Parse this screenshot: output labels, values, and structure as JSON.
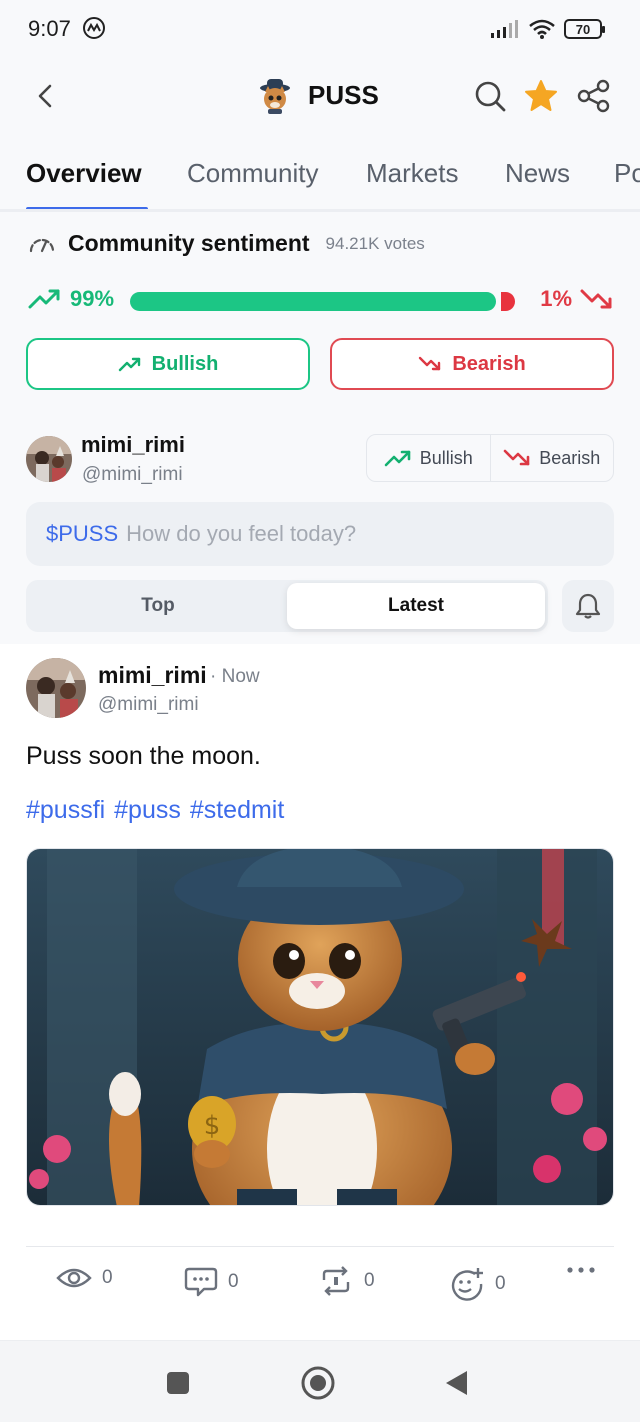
{
  "status_bar": {
    "time": "9:07",
    "battery": "70"
  },
  "header": {
    "coin_name": "PUSS",
    "icons": [
      "back-arrow-icon",
      "search-icon",
      "star-icon",
      "share-icon"
    ],
    "star_color": "#f5a623"
  },
  "tabs": [
    {
      "label": "Overview",
      "active": true
    },
    {
      "label": "Community",
      "active": false
    },
    {
      "label": "Markets",
      "active": false
    },
    {
      "label": "News",
      "active": false
    },
    {
      "label": "Po",
      "active": false
    }
  ],
  "sentiment": {
    "title": "Community sentiment",
    "votes": "94.21K votes",
    "bullish_pct": "99%",
    "bearish_pct": "1%",
    "bullish_fraction": 0.99,
    "bull_color": "#1cc685",
    "bear_color": "#e8333e",
    "bullish_button": "Bullish",
    "bearish_button": "Bearish"
  },
  "composer": {
    "username": "mimi_rimi",
    "handle": "@mimi_rimi",
    "bullish_label": "Bullish",
    "bearish_label": "Bearish",
    "ticker": "$PUSS",
    "placeholder": "How do you feel today?"
  },
  "sort": {
    "options": [
      "Top",
      "Latest"
    ],
    "selected": "Latest"
  },
  "post": {
    "username": "mimi_rimi",
    "time": "· Now",
    "handle": "@mimi_rimi",
    "text": "Puss soon the moon.",
    "tags": "#pussfi #puss #stedmit",
    "image_alt": "cat-in-hat-with-coin-and-gun-image",
    "actions": [
      {
        "icon": "views-icon",
        "count": "0"
      },
      {
        "icon": "comment-icon",
        "count": "0"
      },
      {
        "icon": "repost-icon",
        "count": "0"
      },
      {
        "icon": "add-reaction-icon",
        "count": "0"
      },
      {
        "icon": "more-icon",
        "count": ""
      }
    ]
  },
  "navbar": {
    "icons": [
      "recent-apps-icon",
      "home-icon",
      "back-icon"
    ]
  }
}
